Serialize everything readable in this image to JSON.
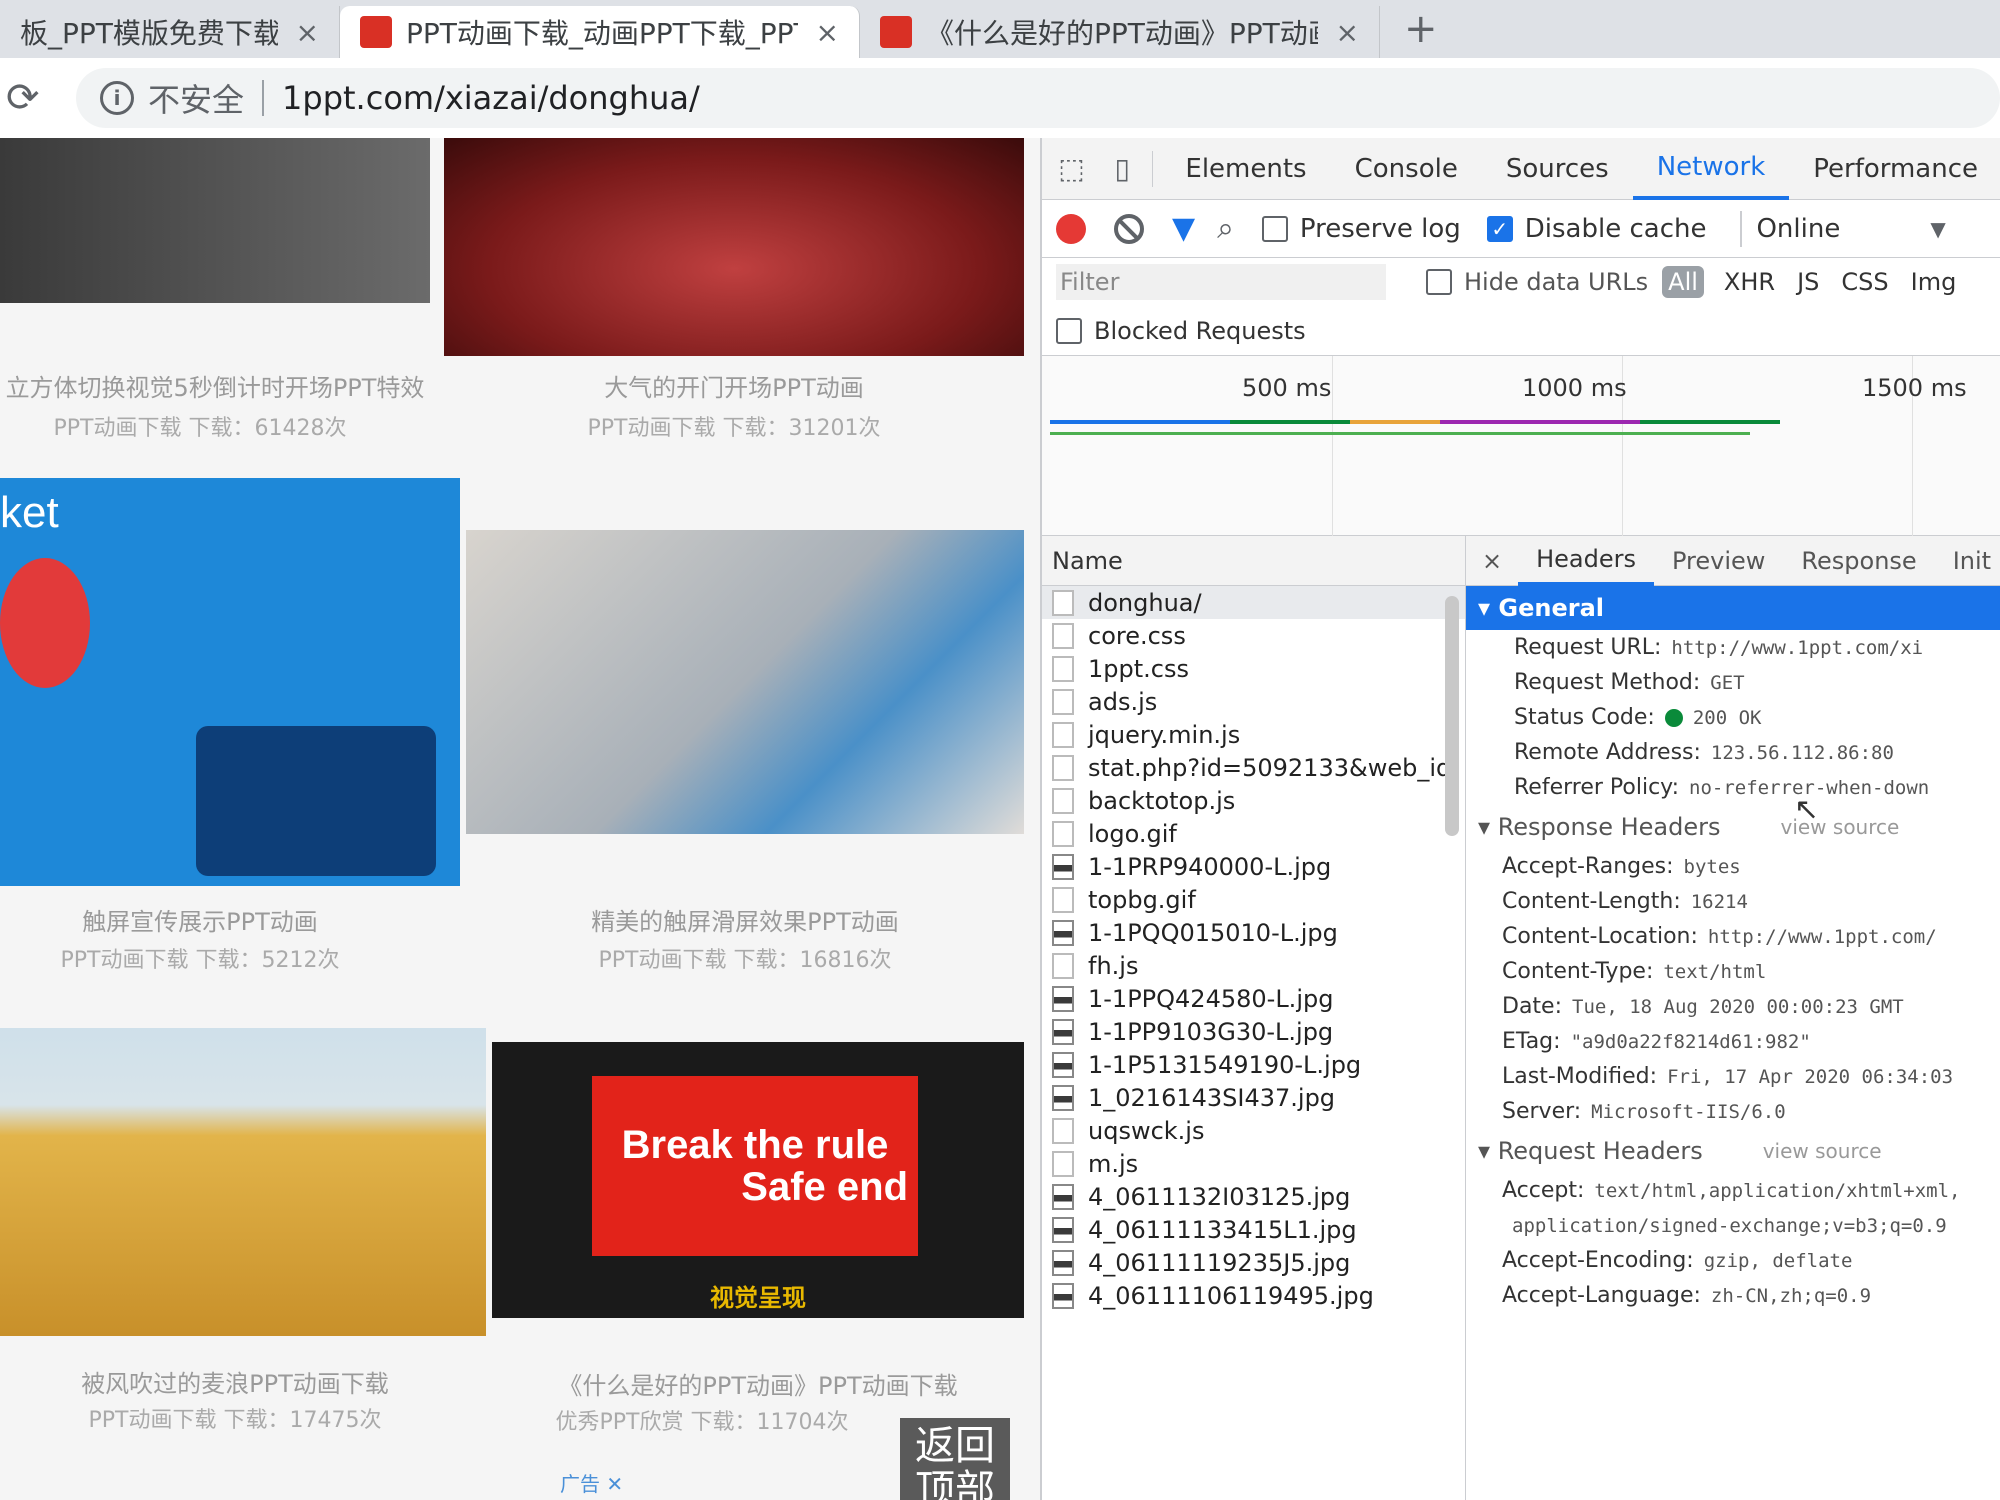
{
  "browser": {
    "tabs": [
      {
        "title": "板_PPT模版免费下载_免费"
      },
      {
        "title": "PPT动画下载_动画PPT下载_PPT"
      },
      {
        "title": "《什么是好的PPT动画》PPT动画"
      }
    ],
    "new_tab_label": "+",
    "tab_close_label": "×",
    "reload_label": "⟳",
    "security_label": "不安全",
    "url": "1ppt.com/xiazai/donghua/"
  },
  "webpage": {
    "cards": [
      {
        "title": "立方体切换视觉5秒倒计时开场PPT特效",
        "meta": "PPT动画下载   下载：61428次"
      },
      {
        "title": "大气的开门开场PPT动画",
        "meta": "PPT动画下载   下载：31201次"
      },
      {
        "title": "触屏宣传展示PPT动画",
        "meta": "PPT动画下载   下载：5212次"
      },
      {
        "title": "精美的触屏滑屏效果PPT动画",
        "meta": "PPT动画下载   下载：16816次"
      },
      {
        "title": "被风吹过的麦浪PPT动画下载",
        "meta": "PPT动画下载   下载：17475次"
      },
      {
        "title": "《什么是好的PPT动画》PPT动画下载",
        "meta": "优秀PPT欣赏   下载：11704次"
      }
    ],
    "promo_line1": "Break the rule",
    "promo_line2": "Safe end",
    "promo_caption": "视觉呈现",
    "ket_label": "ket",
    "back_to_top": "返回顶部",
    "ad_label": "广告 ✕"
  },
  "devtools": {
    "tabs": [
      "Elements",
      "Console",
      "Sources",
      "Network",
      "Performance"
    ],
    "active_tab": "Network",
    "toolbar": {
      "preserve_log": "Preserve log",
      "disable_cache": "Disable cache",
      "throttle": "Online"
    },
    "filter": {
      "placeholder": "Filter",
      "hide_data_urls": "Hide data URLs",
      "types": [
        "All",
        "XHR",
        "JS",
        "CSS",
        "Img"
      ],
      "blocked_requests": "Blocked Requests"
    },
    "timeline": {
      "ticks": [
        "500 ms",
        "1000 ms",
        "1500 ms"
      ]
    },
    "requests": {
      "header": "Name",
      "items": [
        {
          "name": "donghua/",
          "kind": "doc"
        },
        {
          "name": "core.css",
          "kind": "doc"
        },
        {
          "name": "1ppt.css",
          "kind": "doc"
        },
        {
          "name": "ads.js",
          "kind": "doc"
        },
        {
          "name": "jquery.min.js",
          "kind": "doc"
        },
        {
          "name": "stat.php?id=5092133&web_id",
          "kind": "doc"
        },
        {
          "name": "backtotop.js",
          "kind": "doc"
        },
        {
          "name": "logo.gif",
          "kind": "doc"
        },
        {
          "name": "1-1PRP940000-L.jpg",
          "kind": "img"
        },
        {
          "name": "topbg.gif",
          "kind": "doc"
        },
        {
          "name": "1-1PQQ015010-L.jpg",
          "kind": "img"
        },
        {
          "name": "fh.js",
          "kind": "doc"
        },
        {
          "name": "1-1PPQ424580-L.jpg",
          "kind": "img"
        },
        {
          "name": "1-1PP9103G30-L.jpg",
          "kind": "img"
        },
        {
          "name": "1-1P5131549190-L.jpg",
          "kind": "img"
        },
        {
          "name": "1_0216143SI437.jpg",
          "kind": "img"
        },
        {
          "name": "uqswck.js",
          "kind": "doc"
        },
        {
          "name": "m.js",
          "kind": "doc"
        },
        {
          "name": "4_0611132I03125.jpg",
          "kind": "img"
        },
        {
          "name": "4_06111133415L1.jpg",
          "kind": "img"
        },
        {
          "name": "4_06111119235J5.jpg",
          "kind": "img"
        },
        {
          "name": "4_06111106119495.jpg",
          "kind": "img"
        }
      ]
    },
    "detail": {
      "close_label": "×",
      "tabs": [
        "Headers",
        "Preview",
        "Response",
        "Init"
      ],
      "general_title": "General",
      "general": [
        {
          "k": "Request URL:",
          "v": "http://www.1ppt.com/xi"
        },
        {
          "k": "Request Method:",
          "v": "GET"
        },
        {
          "k": "Status Code:",
          "v": "200 OK"
        },
        {
          "k": "Remote Address:",
          "v": "123.56.112.86:80"
        },
        {
          "k": "Referrer Policy:",
          "v": "no-referrer-when-down"
        }
      ],
      "response_title": "Response Headers",
      "request_title": "Request Headers",
      "view_source": "view source",
      "response_headers": [
        {
          "k": "Accept-Ranges:",
          "v": "bytes"
        },
        {
          "k": "Content-Length:",
          "v": "16214"
        },
        {
          "k": "Content-Location:",
          "v": "http://www.1ppt.com/"
        },
        {
          "k": "Content-Type:",
          "v": "text/html"
        },
        {
          "k": "Date:",
          "v": "Tue, 18 Aug 2020 00:00:23 GMT"
        },
        {
          "k": "ETag:",
          "v": "\"a9d0a22f8214d61:982\""
        },
        {
          "k": "Last-Modified:",
          "v": "Fri, 17 Apr 2020 06:34:03"
        },
        {
          "k": "Server:",
          "v": "Microsoft-IIS/6.0"
        }
      ],
      "request_headers": [
        {
          "k": "Accept:",
          "v": "text/html,application/xhtml+xml,"
        },
        {
          "k": "",
          "v": "application/signed-exchange;v=b3;q=0.9"
        },
        {
          "k": "Accept-Encoding:",
          "v": "gzip, deflate"
        },
        {
          "k": "Accept-Language:",
          "v": "zh-CN,zh;q=0.9"
        }
      ]
    }
  }
}
